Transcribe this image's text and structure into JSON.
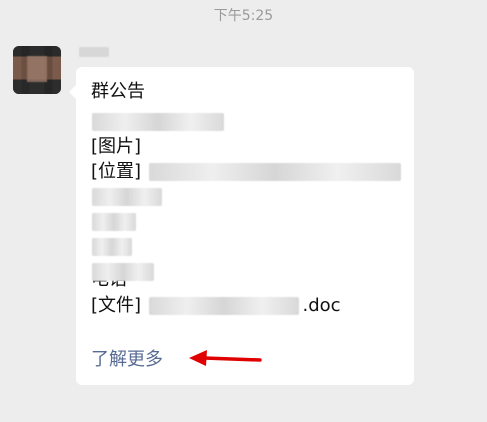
{
  "timestamp": "下午5:25",
  "message": {
    "title": "群公告",
    "items": {
      "image": "[图片]",
      "location": "[位置]",
      "file_prefix": "[文件]",
      "file_suffix": ".doc",
      "phone_partial": "电话"
    },
    "learn_more": "了解更多"
  },
  "colors": {
    "background": "#ededed",
    "bubble": "#ffffff",
    "link": "#576b95",
    "arrow": "#e00000"
  },
  "icons": {
    "avatar": "avatar",
    "annotation_arrow": "arrow-left-icon"
  }
}
